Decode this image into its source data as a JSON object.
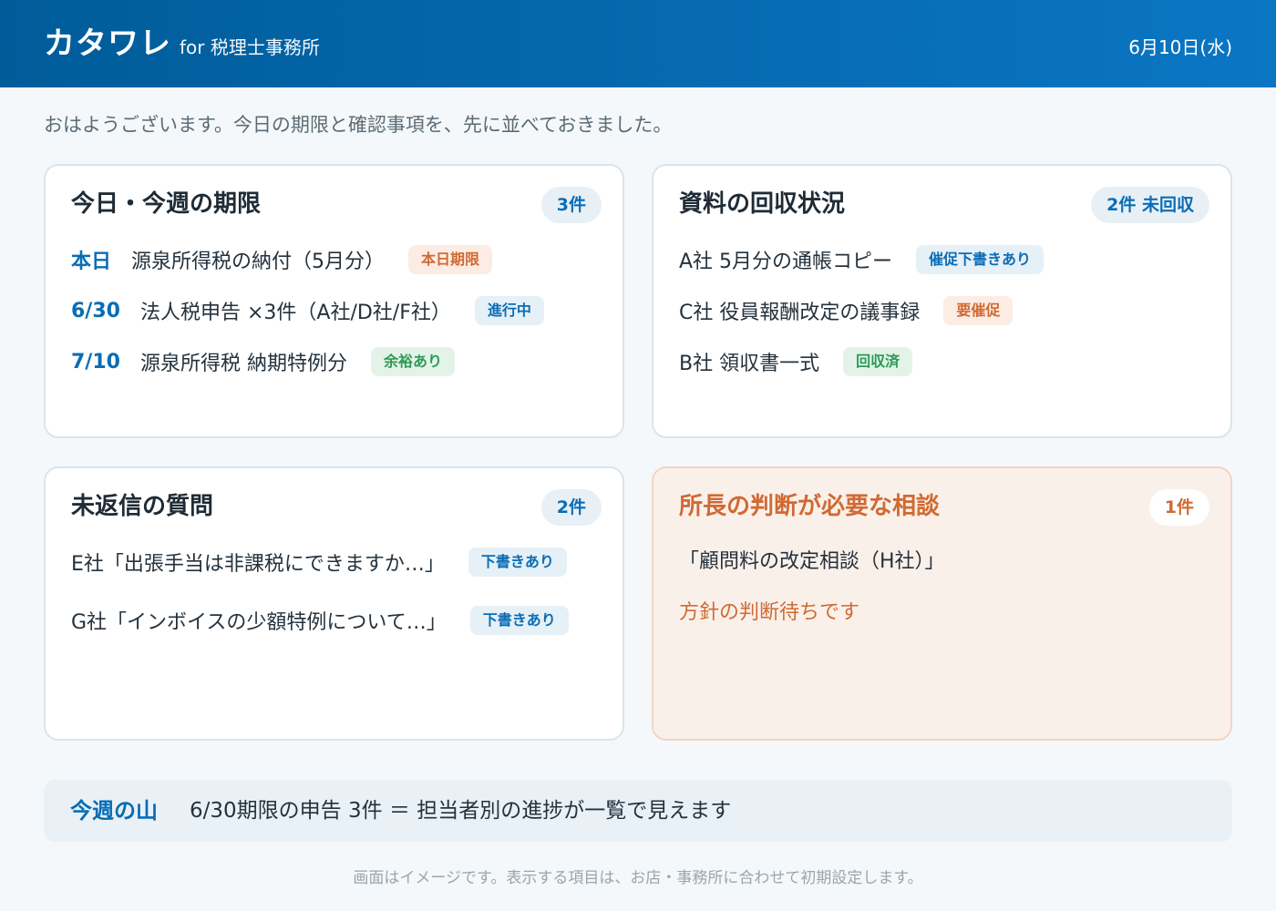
{
  "header": {
    "logo": "カタワレ",
    "subtitle": "for 税理士事務所",
    "date": "6月10日(水)"
  },
  "greeting": "おはようございます。今日の期限と確認事項を、先に並べておきました。",
  "deadlines": {
    "title": "今日・今週の期限",
    "count": "3件",
    "items": [
      {
        "date": "本日",
        "text": "源泉所得税の納付（5月分）",
        "badge": "本日期限"
      },
      {
        "date": "6/30",
        "text": "法人税申告 ×3件（A社/D社/F社）",
        "badge": "進行中"
      },
      {
        "date": "7/10",
        "text": "源泉所得税 納期特例分",
        "badge": "余裕あり"
      }
    ]
  },
  "documents": {
    "title": "資料の回収状況",
    "count": "2件 未回収",
    "items": [
      {
        "text": "A社 5月分の通帳コピー",
        "badge": "催促下書きあり"
      },
      {
        "text": "C社 役員報酬改定の議事録",
        "badge": "要催促"
      },
      {
        "text": "B社 領収書一式",
        "badge": "回収済"
      }
    ]
  },
  "questions": {
    "title": "未返信の質問",
    "count": "2件",
    "items": [
      {
        "text": "E社「出張手当は非課税にできますか…」",
        "badge": "下書きあり"
      },
      {
        "text": "G社「インボイスの少額特例について…」",
        "badge": "下書きあり"
      }
    ]
  },
  "consult": {
    "title": "所長の判断が必要な相談",
    "count": "1件",
    "item": "「顧問料の改定相談（H社）」",
    "note": "方針の判断待ちです"
  },
  "banner": {
    "label": "今週の山",
    "text": "6/30期限の申告 3件 ＝ 担当者別の進捗が一覧で見えます"
  },
  "footer": "画面はイメージです。表示する項目は、お店・事務所に合わせて初期設定します。",
  "colors": {
    "header_start": "#005c99",
    "header_end": "#0a76c4",
    "accent": "#0a6db5",
    "warn": "#d06a33",
    "ok": "#2e9a56"
  }
}
